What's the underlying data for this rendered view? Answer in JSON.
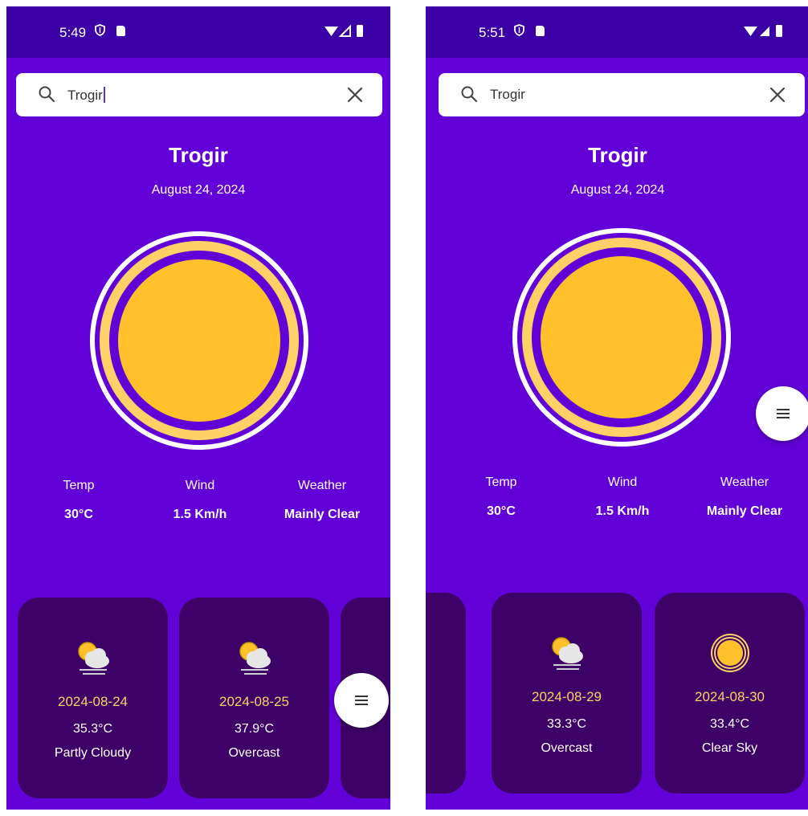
{
  "colors": {
    "background": "#6200d8",
    "statusbar": "#3a00a6",
    "card": "#3d0066",
    "sun": "#ffc12b",
    "ring": "#ffd166",
    "forecast_date": "#ffd166"
  },
  "screens": [
    {
      "status_time": "5:49",
      "search": {
        "value": "Trogir",
        "placeholder": ""
      },
      "city": "Trogir",
      "date": "August 24, 2024",
      "stats": [
        {
          "label": "Temp",
          "value": "30°C"
        },
        {
          "label": "Wind",
          "value": "1.5 Km/h"
        },
        {
          "label": "Weather",
          "value": "Mainly Clear"
        }
      ],
      "forecast": [
        {
          "date": "2024-08-24",
          "temp": "35.3°C",
          "desc": "Partly Cloudy",
          "icon": "partly-cloudy-icon"
        },
        {
          "date": "2024-08-25",
          "temp": "37.9°C",
          "desc": "Overcast",
          "icon": "partly-cloudy-icon"
        }
      ],
      "fab_icon": "menu-icon"
    },
    {
      "status_time": "5:51",
      "search": {
        "value": "Trogir",
        "placeholder": ""
      },
      "city": "Trogir",
      "date": "August 24, 2024",
      "stats": [
        {
          "label": "Temp",
          "value": "30°C"
        },
        {
          "label": "Wind",
          "value": "1.5 Km/h"
        },
        {
          "label": "Weather",
          "value": "Mainly Clear"
        }
      ],
      "forecast": [
        {
          "date": "2024-08-29",
          "temp": "33.3°C",
          "desc": "Overcast",
          "icon": "partly-cloudy-icon"
        },
        {
          "date": "2024-08-30",
          "temp": "33.4°C",
          "desc": "Clear Sky",
          "icon": "sun-icon"
        }
      ],
      "fab_icon": "menu-icon"
    }
  ]
}
